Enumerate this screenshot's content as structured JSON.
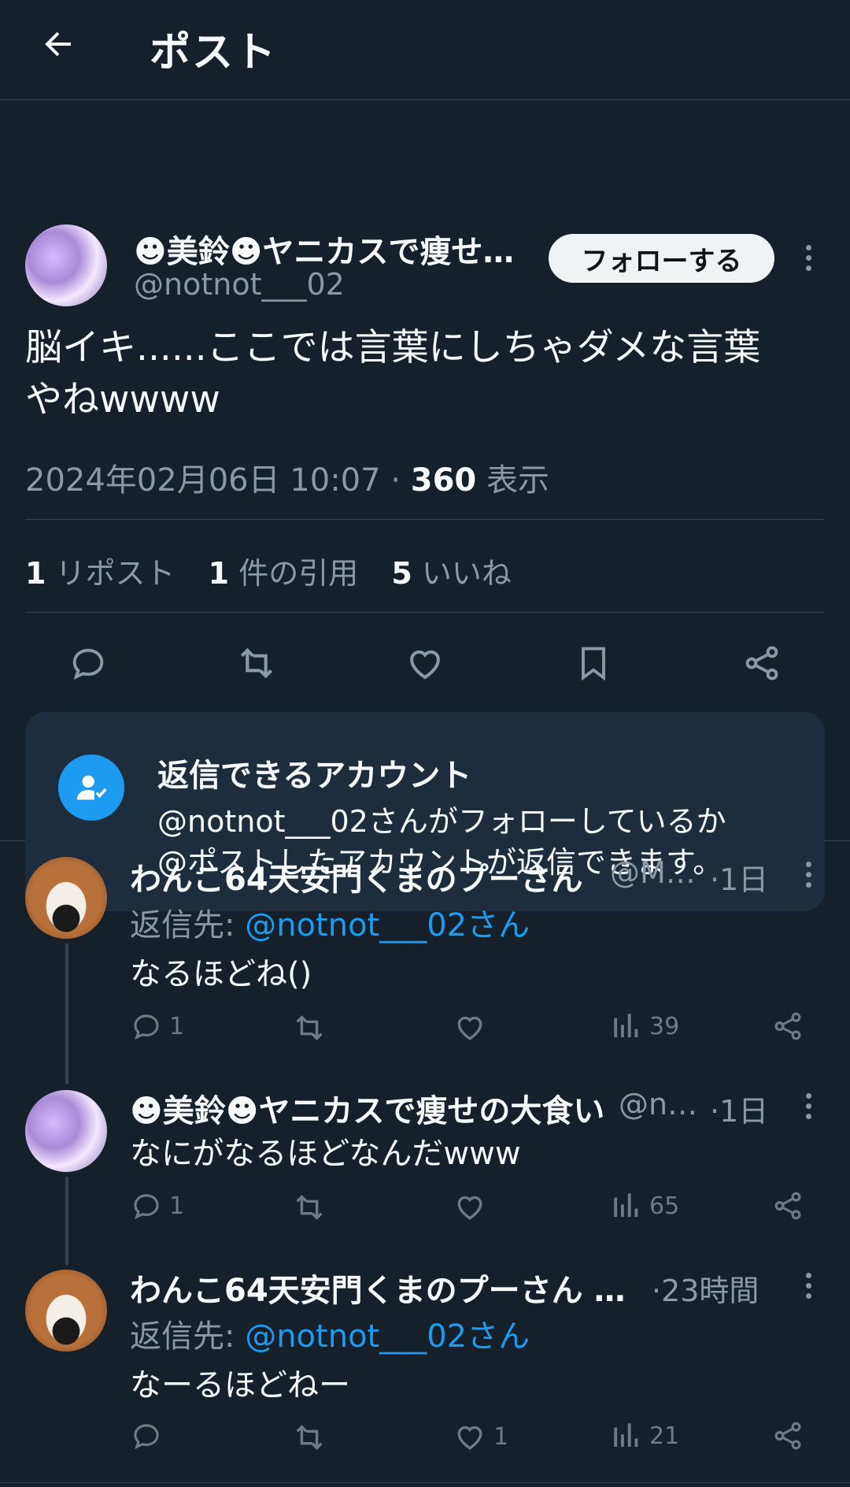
{
  "header": {
    "title": "ポスト"
  },
  "post": {
    "author_name": "☻美鈴☻ヤニカスで痩せ…",
    "author_handle": "@notnot___02",
    "follow_label": "フォローする",
    "text_line1": "脳イキ......ここでは言葉にしちゃダメな言葉",
    "text_line2": "やねwwww",
    "timestamp": "2024年02月06日 10:07",
    "separator": "·",
    "views_count": "360",
    "views_label": "表示",
    "reposts_count": "1",
    "reposts_label": "リポスト",
    "quotes_count": "1",
    "quotes_label": "件の引用",
    "likes_count": "5",
    "likes_label": "いいね"
  },
  "reply_notice": {
    "title": "返信できるアカウント",
    "line1": "@notnot___02さんがフォローしているか",
    "line2": "@ポストしたアカウントが返信できます。"
  },
  "replies": [
    {
      "name": "わんこ64天安門くまのプーさん",
      "handle": "@M…",
      "time": "·1日",
      "reply_to_label": "返信先:",
      "reply_to": "@notnot___02さん",
      "text": "なるほどね()",
      "reply_count": "1",
      "like_count": "",
      "view_count": "39"
    },
    {
      "name": "☻美鈴☻ヤニカスで痩せの大食い",
      "handle": "@n…",
      "time": "·1日",
      "text": "なにがなるほどなんだwww",
      "reply_count": "1",
      "like_count": "",
      "view_count": "65"
    },
    {
      "name": "わんこ64天安門くまのプーさん …",
      "handle": "",
      "time": "·23時間",
      "reply_to_label": "返信先:",
      "reply_to": "@notnot___02さん",
      "text": "なーるほどねー",
      "reply_count": "",
      "like_count": "1",
      "view_count": "21"
    }
  ],
  "colors": {
    "background": "#15202b",
    "accent": "#1d9bf0",
    "muted": "#8b98a5",
    "divider": "#38444d"
  }
}
